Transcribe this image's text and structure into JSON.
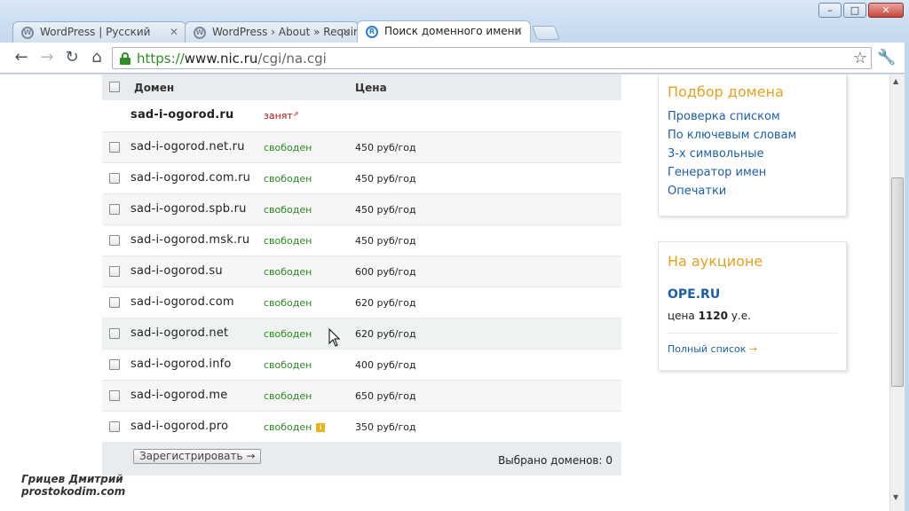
{
  "window": {
    "controls": {
      "minimize": "–",
      "maximize": "□",
      "close": "✕"
    }
  },
  "tabs": [
    {
      "title": "WordPress | Русский",
      "favicon": "W",
      "active": false
    },
    {
      "title": "WordPress › About » Requir",
      "favicon": "W",
      "active": false
    },
    {
      "title": "Поиск доменного имени",
      "favicon": "R",
      "active": true
    }
  ],
  "toolbar": {
    "url_scheme": "https://",
    "url_host": "www.nic.ru",
    "url_path": "/cgi/na.cgi",
    "back_icon": "back-arrow-icon",
    "forward_icon": "forward-arrow-icon",
    "reload_icon": "reload-icon",
    "home_icon": "home-icon"
  },
  "results": {
    "header": {
      "domain": "Домен",
      "price": "Цена"
    },
    "rows": [
      {
        "domain": "sad-i-ogorod.ru",
        "status": "занят",
        "price": ""
      },
      {
        "domain": "sad-i-ogorod.net.ru",
        "status": "свободен",
        "price": "450 руб/год"
      },
      {
        "domain": "sad-i-ogorod.com.ru",
        "status": "свободен",
        "price": "450 руб/год"
      },
      {
        "domain": "sad-i-ogorod.spb.ru",
        "status": "свободен",
        "price": "450 руб/год"
      },
      {
        "domain": "sad-i-ogorod.msk.ru",
        "status": "свободен",
        "price": "450 руб/год"
      },
      {
        "domain": "sad-i-ogorod.su",
        "status": "свободен",
        "price": "600 руб/год"
      },
      {
        "domain": "sad-i-ogorod.com",
        "status": "свободен",
        "price": "620 руб/год"
      },
      {
        "domain": "sad-i-ogorod.net",
        "status": "свободен",
        "price": "620 руб/год"
      },
      {
        "domain": "sad-i-ogorod.info",
        "status": "свободен",
        "price": "400 руб/год"
      },
      {
        "domain": "sad-i-ogorod.me",
        "status": "свободен",
        "price": "650 руб/год"
      },
      {
        "domain": "sad-i-ogorod.pro",
        "status": "свободен",
        "price": "350 руб/год"
      }
    ],
    "register_button": "Зарегистрировать →",
    "selected_label": "Выбрано доменов:",
    "selected_count": "0"
  },
  "sidebar": {
    "picker": {
      "title": "Подбор домена",
      "links": [
        "Проверка списком",
        "По ключевым словам",
        "3-х символьные",
        "Генератор имен",
        "Опечатки"
      ]
    },
    "auction": {
      "title": "На аукционе",
      "domain": "OPE.RU",
      "price_prefix": "цена",
      "price_value": "1120",
      "price_suffix": "у.е.",
      "full_list": "Полный список",
      "full_list_arrow": "→"
    }
  },
  "watermark": {
    "line1": "Грицев Дмитрий",
    "line2": "prostokodim.com"
  },
  "colors": {
    "free": "#2a8a1e",
    "taken": "#b01818",
    "link": "#1c5fa8",
    "accent": "#e8a020"
  }
}
